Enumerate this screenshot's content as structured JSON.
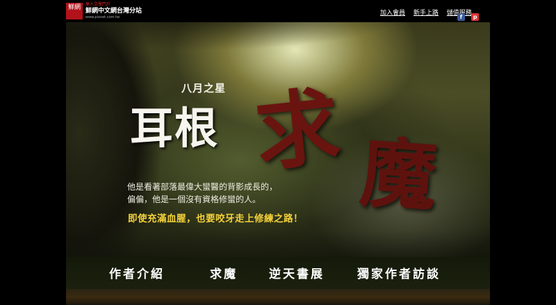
{
  "header": {
    "logo_text": "鮮網",
    "brand_tag": "華人文學門戶",
    "brand_name": "鮮網中文網台灣分站",
    "brand_url": "www.pixnet.com.tw",
    "links": [
      "加入會員",
      "新手上路",
      "儲值服務"
    ],
    "social_icons": [
      "facebook-icon",
      "plurk-icon",
      "twitter-icon"
    ]
  },
  "hero": {
    "subtitle": "八月之星",
    "author": "耳根",
    "book_title_a": "求",
    "book_title_b": "魔",
    "description_line1": "他是看著部落最偉大蠻醫的背影成長的，",
    "description_line2": "偏偏，他是一個沒有資格修蠻的人。",
    "slogan": "即使充滿血腥，也要咬牙走上修練之路！"
  },
  "nav": {
    "items": [
      "作者介紹",
      "求魔",
      "逆天書展",
      "獨家作者訪談"
    ]
  },
  "colors": {
    "accent_red": "#6a1410",
    "slogan_yellow": "#f4d23a",
    "logo_red": "#b3121b"
  }
}
